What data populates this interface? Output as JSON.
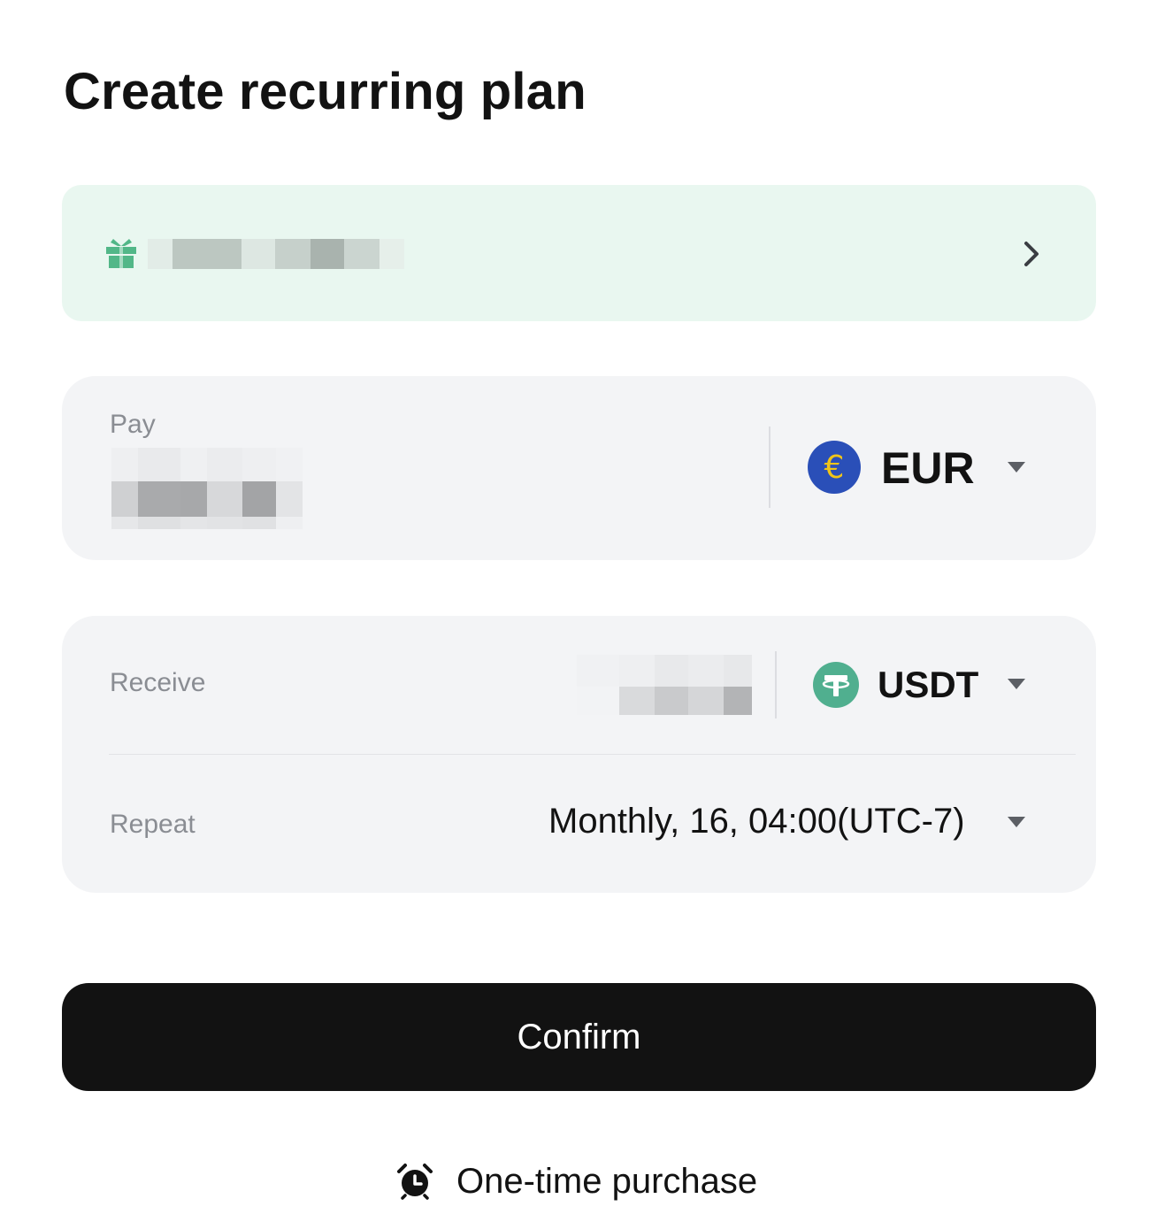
{
  "page": {
    "title": "Create recurring plan"
  },
  "promo": {
    "icon": "gift-icon",
    "chevron_icon": "chevron-right-icon",
    "text_redacted": true
  },
  "pay": {
    "label": "Pay",
    "amount_redacted": true,
    "currency": {
      "code": "EUR",
      "icon": "euro-coin-icon",
      "coin_color": "#2a4fb8",
      "symbol_color": "#f0c419"
    }
  },
  "receive": {
    "label": "Receive",
    "amount_redacted": true,
    "currency": {
      "code": "USDT",
      "icon": "tether-coin-icon",
      "coin_color": "#50af8f"
    }
  },
  "repeat": {
    "label": "Repeat",
    "value": "Monthly, 16, 04:00(UTC-7)"
  },
  "actions": {
    "confirm_label": "Confirm",
    "one_time_label": "One-time purchase",
    "one_time_icon": "alarm-clock-icon"
  },
  "colors": {
    "promo_bg": "#e9f7f0",
    "card_bg": "#f3f4f6",
    "primary_button": "#121212",
    "accent_green": "#4caf82"
  }
}
